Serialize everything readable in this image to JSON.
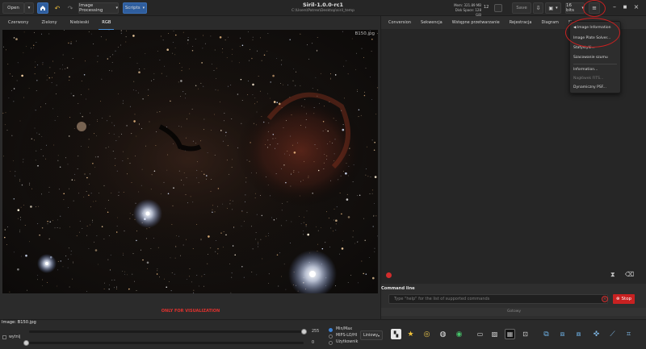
{
  "header": {
    "open_label": "Open",
    "image_processing_label": "Image Processing",
    "scripts_label": "Scripts",
    "title": "Siril-1.0.0-rc1",
    "path": "C:\\Users\\Patrex\\Desktop\\siril_temp",
    "mem_line1": "Mem: 321.89 MB",
    "mem_line2": "Disk Space: 128 GiB",
    "cpu_count": "12",
    "save_label": "Save",
    "bits_label": "16 bits"
  },
  "left_tabs": [
    "Czerwony",
    "Zielony",
    "Niebieski",
    "RGB"
  ],
  "viewer": {
    "image_name": "B150.jpg",
    "viz_text": "ONLY FOR VISUALIZATION"
  },
  "right_tabs": [
    "Conversion",
    "Sekwencja",
    "Wstępne przetwarzanie",
    "Rejestracja",
    "Diagram",
    "Stackowa"
  ],
  "command": {
    "label": "Command line",
    "placeholder": "Type \"help\" for the list of supported commands",
    "stop_label": "Stop",
    "status_text": "Gotowy"
  },
  "menu": {
    "items": [
      {
        "label": "Image Information",
        "arrow": "◀",
        "disabled": false
      },
      {
        "label": "Image Plate Solver...",
        "disabled": false
      },
      {
        "label": "Statystyki...",
        "disabled": false
      },
      {
        "label": "Szacowanie szumu",
        "disabled": false
      },
      {
        "label": "Information...",
        "disabled": false
      },
      {
        "label": "Nagłówek FITS...",
        "disabled": true
      },
      {
        "label": "Dynamiczny PSF...",
        "disabled": false
      }
    ]
  },
  "bottom": {
    "file_label": "Image: B150.jpg",
    "slider_high_value": "255",
    "slider_low_value": "0",
    "checkbox_label": "wytnij",
    "radios": [
      "Min/Max",
      "MIPS-LO/HI",
      "Użytkownik"
    ],
    "radio_selected": 0,
    "mode_value": "Liniowy"
  },
  "colors": {
    "accent_blue": "#2f5e9e",
    "stop_red": "#c82121",
    "annotation_red": "#c72121",
    "viz_red": "#e0322e"
  }
}
